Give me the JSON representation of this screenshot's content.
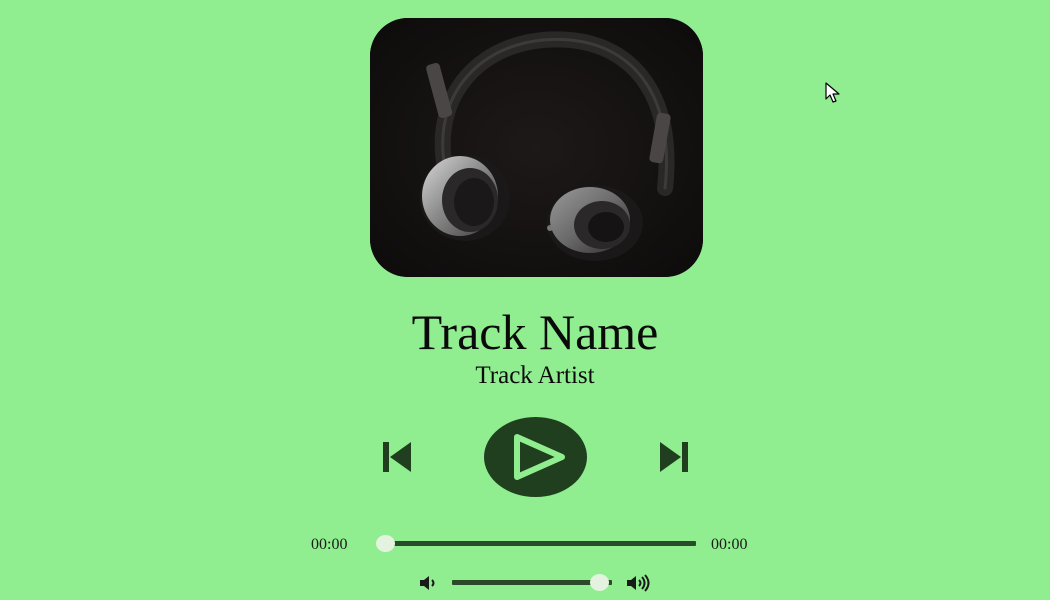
{
  "track": {
    "name": "Track Name",
    "artist": "Track Artist"
  },
  "album_art": {
    "image": "headphones-photo"
  },
  "controls": {
    "prev_icon": "skip-previous-icon",
    "play_icon": "play-icon",
    "next_icon": "skip-next-icon"
  },
  "seek": {
    "current_time": "00:00",
    "total_time": "00:00",
    "progress": 0
  },
  "volume": {
    "level": 0.95,
    "low_icon": "volume-low-icon",
    "high_icon": "volume-high-icon"
  },
  "colors": {
    "background": "#90ee90",
    "button_dark": "#1f3f1f",
    "slider_thumb": "#e3f3df"
  }
}
